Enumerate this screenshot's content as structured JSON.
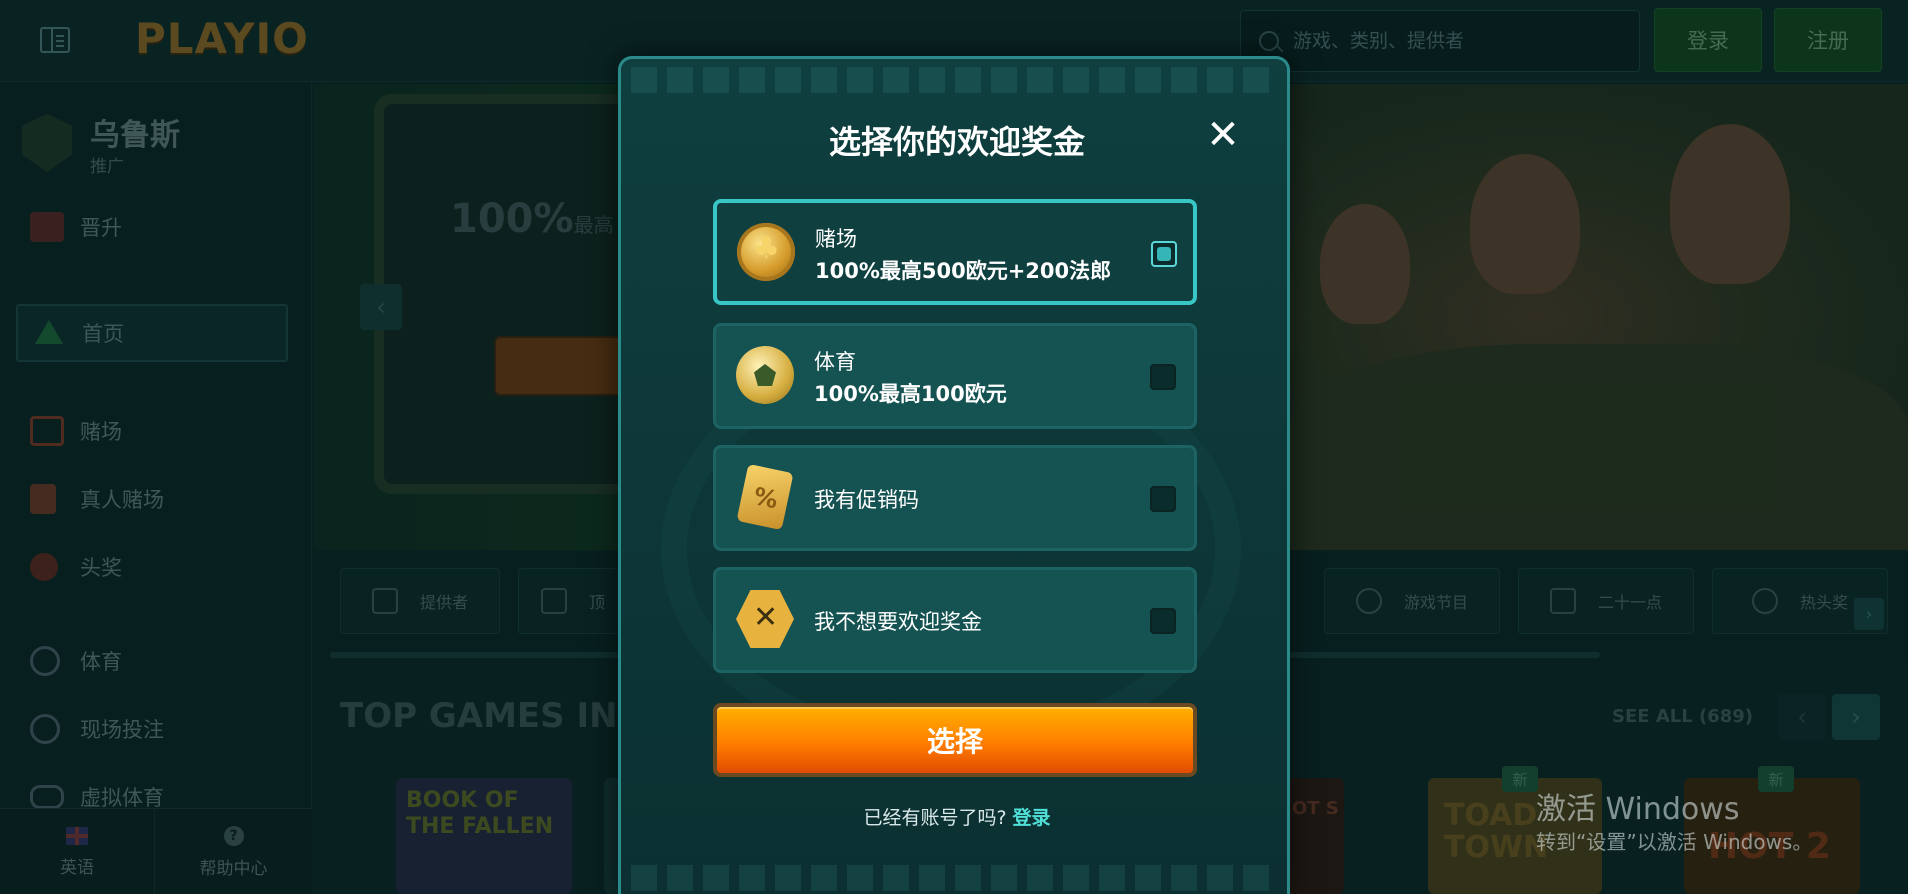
{
  "header": {
    "logo": "PLAYIO",
    "search": {
      "placeholder": "游戏、类别、提供者"
    },
    "login_label": "登录",
    "register_label": "注册"
  },
  "sidebar": {
    "user": {
      "name": "乌鲁斯",
      "subtitle": "推广"
    },
    "items": [
      {
        "label": "晋升",
        "icon": "promotion-icon"
      },
      {
        "label": "首页",
        "icon": "home-icon",
        "active": true
      },
      {
        "label": "赌场",
        "icon": "casino-icon"
      },
      {
        "label": "真人赌场",
        "icon": "live-casino-icon"
      },
      {
        "label": "头奖",
        "icon": "jackpot-icon"
      },
      {
        "label": "体育",
        "icon": "sports-icon"
      },
      {
        "label": "现场投注",
        "icon": "live-betting-icon"
      },
      {
        "label": "虚拟体育",
        "icon": "virtual-sports-icon"
      }
    ],
    "language_label": "英语",
    "help_label": "帮助中心"
  },
  "hero": {
    "percent": "100%",
    "percent_suffix": "最高"
  },
  "categories": [
    {
      "label": "提供者",
      "icon": "providers-icon"
    },
    {
      "label": "顶",
      "icon": "top-icon"
    },
    {
      "label": "游戏节目",
      "icon": "game-shows-icon"
    },
    {
      "label": "二十一点",
      "icon": "blackjack-icon"
    },
    {
      "label": "热头奖",
      "icon": "hot-jackpot-icon"
    }
  ],
  "top_games": {
    "title": "TOP GAMES IN S",
    "see_all": "SEE ALL (689)",
    "games": [
      {
        "title": "BOOK OF THE FALLEN"
      },
      {
        "title": "OT S"
      },
      {
        "title": "TOAD TOWN",
        "badge": "新"
      },
      {
        "title": "HOT 2",
        "badge": "新"
      }
    ]
  },
  "modal": {
    "title": "选择你的欢迎奖金",
    "close_icon": "close-icon",
    "options": [
      {
        "label": "赌场",
        "detail": "100%最高500欧元+200法郎",
        "icon": "casino-coin-icon",
        "selected": true
      },
      {
        "label": "体育",
        "detail": "100%最高100欧元",
        "icon": "soccer-ball-icon",
        "selected": false
      },
      {
        "label": "我有促销码",
        "detail": "",
        "icon": "promo-ticket-icon",
        "selected": false
      },
      {
        "label": "我不想要欢迎奖金",
        "detail": "",
        "icon": "no-bonus-icon",
        "selected": false
      }
    ],
    "select_label": "选择",
    "account_question": "已经有账号了吗?",
    "login_link": "登录"
  },
  "watermark": {
    "title": "激活 Windows",
    "subtitle": "转到“设置”以激活 Windows。"
  },
  "colors": {
    "accent": "#39c6c6",
    "button_orange": "#ff7e00",
    "link": "#4fe0d8"
  }
}
